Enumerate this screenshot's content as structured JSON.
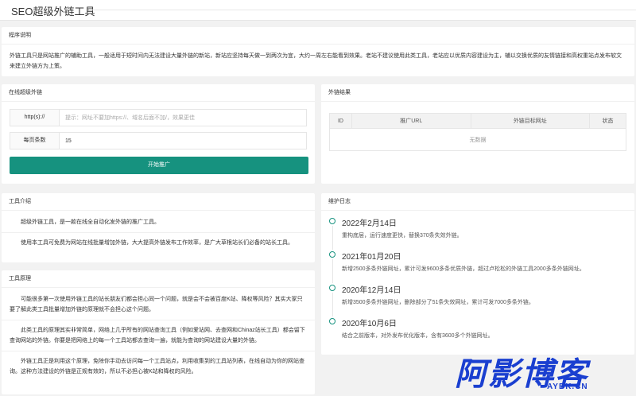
{
  "app_title": "SEO超级外链工具",
  "intro": {
    "title": "程序说明",
    "text": "外链工具只是网站推广的辅助工具，一般适用于短时间内无法建设大量外链的新站，新站应坚持每天做一到两次为宜，大约一周左右能看到效果。老站不建议使用此类工具，老站应以优质内容建设为主，辅以交换优质的友情链接和高权重站点发布软文来建立外链方为上策。"
  },
  "online": {
    "title": "在线超级外链",
    "url_label": "http(s)://",
    "url_placeholder": "提示：网址不要加https://、域名后面不加/，效果更佳",
    "url_value": "",
    "count_label": "每页条数",
    "count_value": "15",
    "start_button": "开始推广"
  },
  "result": {
    "title": "外链结果",
    "columns": [
      "ID",
      "推广URL",
      "外链目标网址",
      "状态"
    ],
    "empty_text": "无数据"
  },
  "tool_intro": {
    "title": "工具介绍",
    "paragraphs": [
      "超级外链工具，是一款在线全自动化发外链的推广工具。",
      "使用本工具可免费为网站在线批量增加外链，大大提高外链发布工作效率，是广大草根站长们必备的站长工具。"
    ]
  },
  "principle": {
    "title": "工具原理",
    "paragraphs": [
      "可能很多第一次使用外链工具的站长朋友们都会担心同一个问题，就是会不会被百度K站、降权等风险？其实大家只要了解此类工具批量增加外链的原理就不会担心这个问题。",
      "此类工具的原理其实非常简单，网络上几乎所有的网站查询工具（例如爱站网、去查网和Chinaz站长工具）都会留下查询网站的外链。你要是把网络上的每一个工具站都去查询一遍，就能为查询的网站建设大量的外链。",
      "外链工具正是利用这个原理，免除你手动去访问每一个工具站点，利用收集到的工具站列表，在线自动为你的网站查询。这种方法建设的外链是正规有效的，所以不必担心被K站和降权的风险。"
    ]
  },
  "changelog": {
    "title": "维护日志",
    "items": [
      {
        "date": "2022年2月14日",
        "text": "重构底层，运行速度更快，替换370条失效外链。"
      },
      {
        "date": "2021年01月20日",
        "text": "新增2500多条外链网址，累计可发9600多条优质外链，超过卢松松的外链工具2000多条外链网址。"
      },
      {
        "date": "2020年12月14日",
        "text": "新增3500多条外链网址，删除部分了51条失效网址，累计可发7000多条外链。"
      },
      {
        "date": "2020年10月6日",
        "text": "结合之前版本，对外发布优化版本，含有3600多个外链网址。"
      }
    ]
  },
  "watermark": {
    "big": "阿影博客",
    "small": "AYBK.CN"
  },
  "colors": {
    "accent": "#16927f",
    "watermark": "#1a3fd0"
  }
}
